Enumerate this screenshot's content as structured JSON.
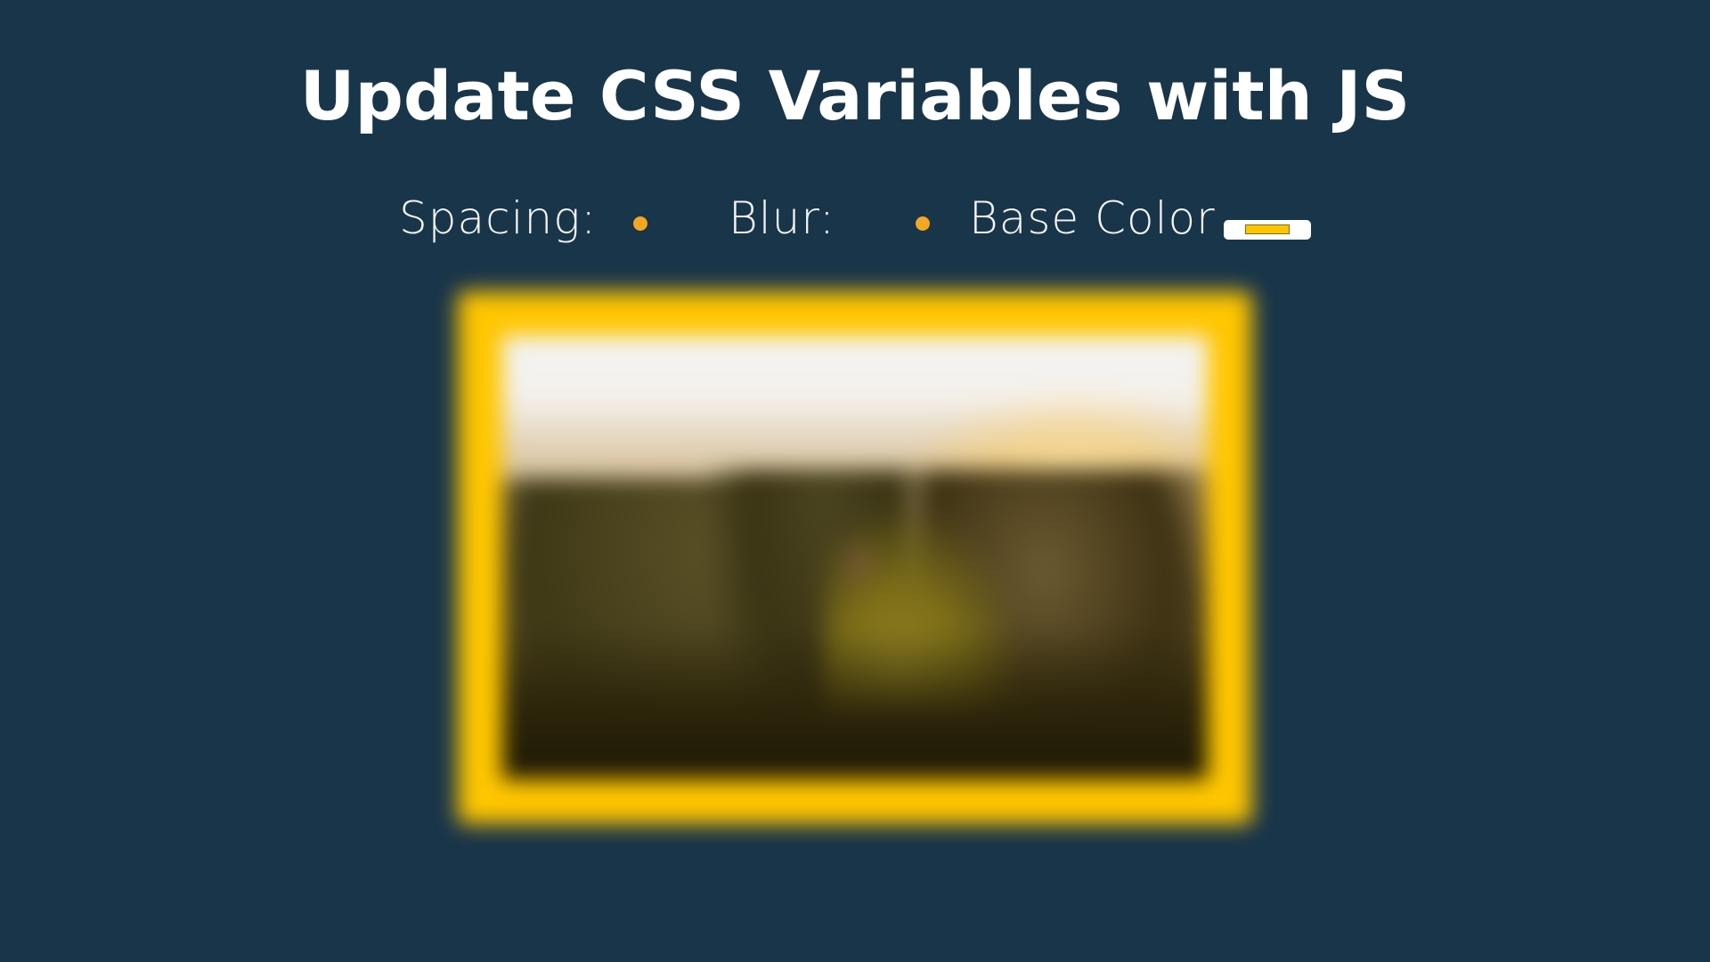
{
  "page": {
    "title": "Update CSS Variables with JS"
  },
  "controls": {
    "spacing": {
      "label": "Spacing:"
    },
    "blur": {
      "label": "Blur:"
    },
    "base_color": {
      "label": "Base Color",
      "value": "#ffc600"
    }
  },
  "colors": {
    "background": "#193549",
    "accent": "#ffc600",
    "slider_thumb": "#f5a623",
    "title_text": "#ffffff"
  },
  "image": {
    "subject": "blurred mountain landscape with hiker"
  }
}
